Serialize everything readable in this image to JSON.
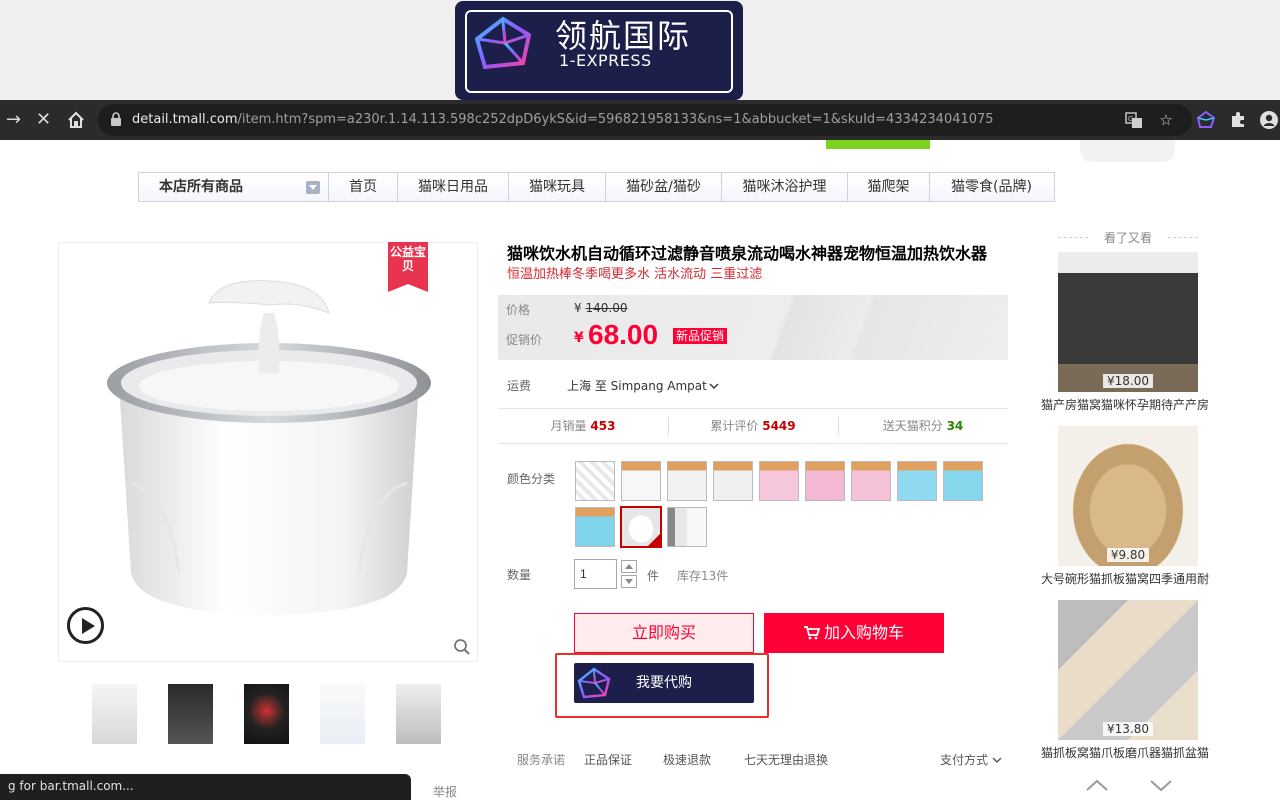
{
  "brand": {
    "name_cn": "领航国际",
    "name_en": "1-EXPRESS"
  },
  "browser": {
    "url_host": "detail.tmall.com",
    "url_path": "/item.htm?spm=a230r.1.14.113.598c252dpD6ykS&id=596821958133&ns=1&abbucket=1&skuId=4334234041075",
    "icons": [
      "forward-icon",
      "stop-loading-icon",
      "home-icon",
      "lock-icon",
      "translate-icon",
      "star-icon",
      "extension-1express-icon",
      "puzzle-icon",
      "profile-icon"
    ]
  },
  "store_nav": {
    "category": "本店所有商品",
    "items": [
      "首页",
      "猫咪日用品",
      "猫咪玩具",
      "猫砂盆/猫砂",
      "猫咪沐浴护理",
      "猫爬架",
      "猫零食(品牌)"
    ]
  },
  "product": {
    "badge": "公益宝贝",
    "title": "猫咪饮水机自动循环过滤静音喷泉流动喝水神器宠物恒温加热饮水器",
    "subtitle": "恒温加热棒冬季喝更多水 活水流动 三重过滤",
    "price_label": "价格",
    "price_currency": "¥",
    "old_price": "140.00",
    "promo_label": "促销价",
    "promo_currency": "¥",
    "promo_price": "68.00",
    "promo_tag": "新品促销",
    "shipping_label": "运费",
    "shipping_value": "上海 至 Simpang Ampat",
    "stats": [
      {
        "label": "月销量",
        "value": "453"
      },
      {
        "label": "累计评价",
        "value": "5449"
      },
      {
        "label": "送天猫积分",
        "value": "34"
      }
    ],
    "color_label": "颜色分类",
    "qty_label": "数量",
    "qty_value": "1",
    "qty_unit": "件",
    "stock": "库存13件",
    "buy_now": "立即购买",
    "add_cart": "加入购物车",
    "proxy_buy": "我要代购",
    "service_label": "服务承诺",
    "services": [
      "正品保证",
      "极速退款",
      "七天无理由退换"
    ],
    "payment": "支付方式"
  },
  "sidebar": {
    "title": "看了又看",
    "items": [
      {
        "price": "¥18.00",
        "name": "猫产房猫窝猫咪怀孕期待产产房"
      },
      {
        "price": "¥9.80",
        "name": "大号碗形猫抓板猫窝四季通用耐磨"
      },
      {
        "price": "¥13.80",
        "name": "猫抓板窝猫爪板磨爪器猫抓盆猫窝"
      }
    ]
  },
  "status_text": "g for bar.tmall.com...",
  "report": "举报",
  "colors": {
    "tmall_red": "#ff0036",
    "navy": "#1c1f4a",
    "highlight_frame": "#e8302b"
  }
}
